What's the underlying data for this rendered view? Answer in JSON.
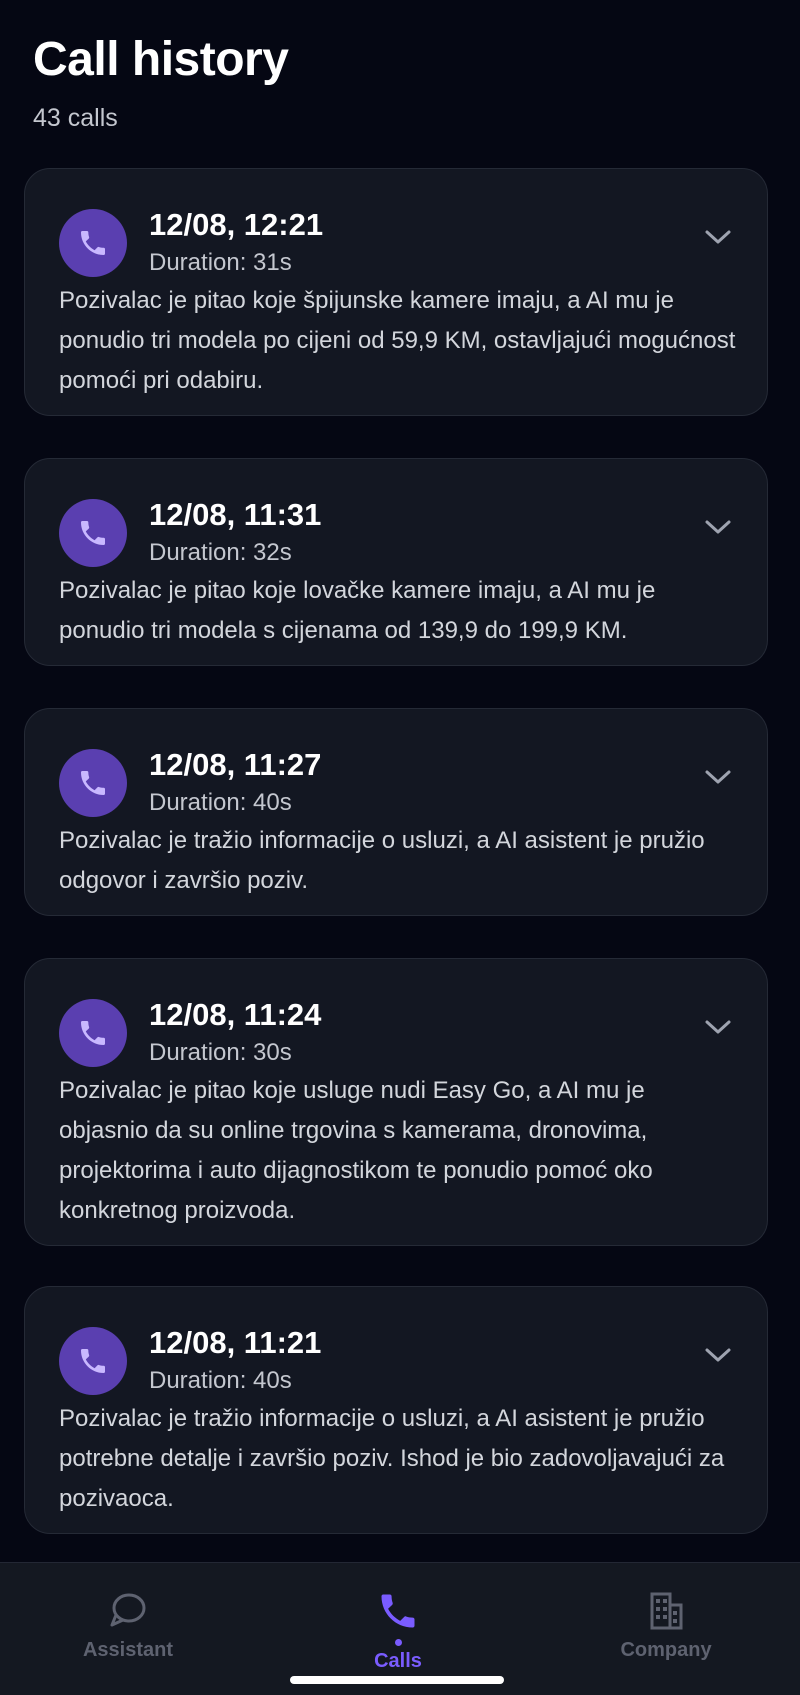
{
  "header": {
    "title": "Call history",
    "subtitle": "43 calls"
  },
  "calls": [
    {
      "time": "12/08, 12:21",
      "duration": "Duration: 31s",
      "summary": "Pozivalac je pitao koje špijunske kamere imaju, a AI mu je ponudio tri modela po cijeni od 59,9 KM, ostavljajući mogućnost pomoći pri odabiru."
    },
    {
      "time": "12/08, 11:31",
      "duration": "Duration: 32s",
      "summary": "Pozivalac je pitao koje lovačke kamere imaju, a AI mu je ponudio tri modela s cijenama od 139,9 do 199,9 KM."
    },
    {
      "time": "12/08, 11:27",
      "duration": "Duration: 40s",
      "summary": "Pozivalac je tražio informacije o usluzi, a AI asistent je pružio odgovor i završio poziv."
    },
    {
      "time": "12/08, 11:24",
      "duration": "Duration: 30s",
      "summary": "Pozivalac je pitao koje usluge nudi Easy Go, a AI mu je objasnio da su online trgovina s kamerama, dronovima, projektorima i auto dijagnostikom te ponudio pomoć oko konkretnog proizvoda."
    },
    {
      "time": "12/08, 11:21",
      "duration": "Duration: 40s",
      "summary": "Pozivalac je tražio informacije o usluzi, a AI asistent je pružio potrebne detalje i završio poziv. Ishod je bio zadovoljavajući za pozivaoca."
    }
  ],
  "nav": {
    "assistant_label": "Assistant",
    "calls_label": "Calls",
    "company_label": "Company",
    "active": "Calls"
  },
  "colors": {
    "background": "#050713",
    "card": "#131722",
    "accent": "#7a5cff",
    "avatar": "#5a3fb0"
  },
  "icons": {
    "avatar": "phone-icon",
    "expand": "chevron-down-icon",
    "assistant": "chat-bubble-icon",
    "calls": "phone-icon",
    "company": "building-icon"
  }
}
